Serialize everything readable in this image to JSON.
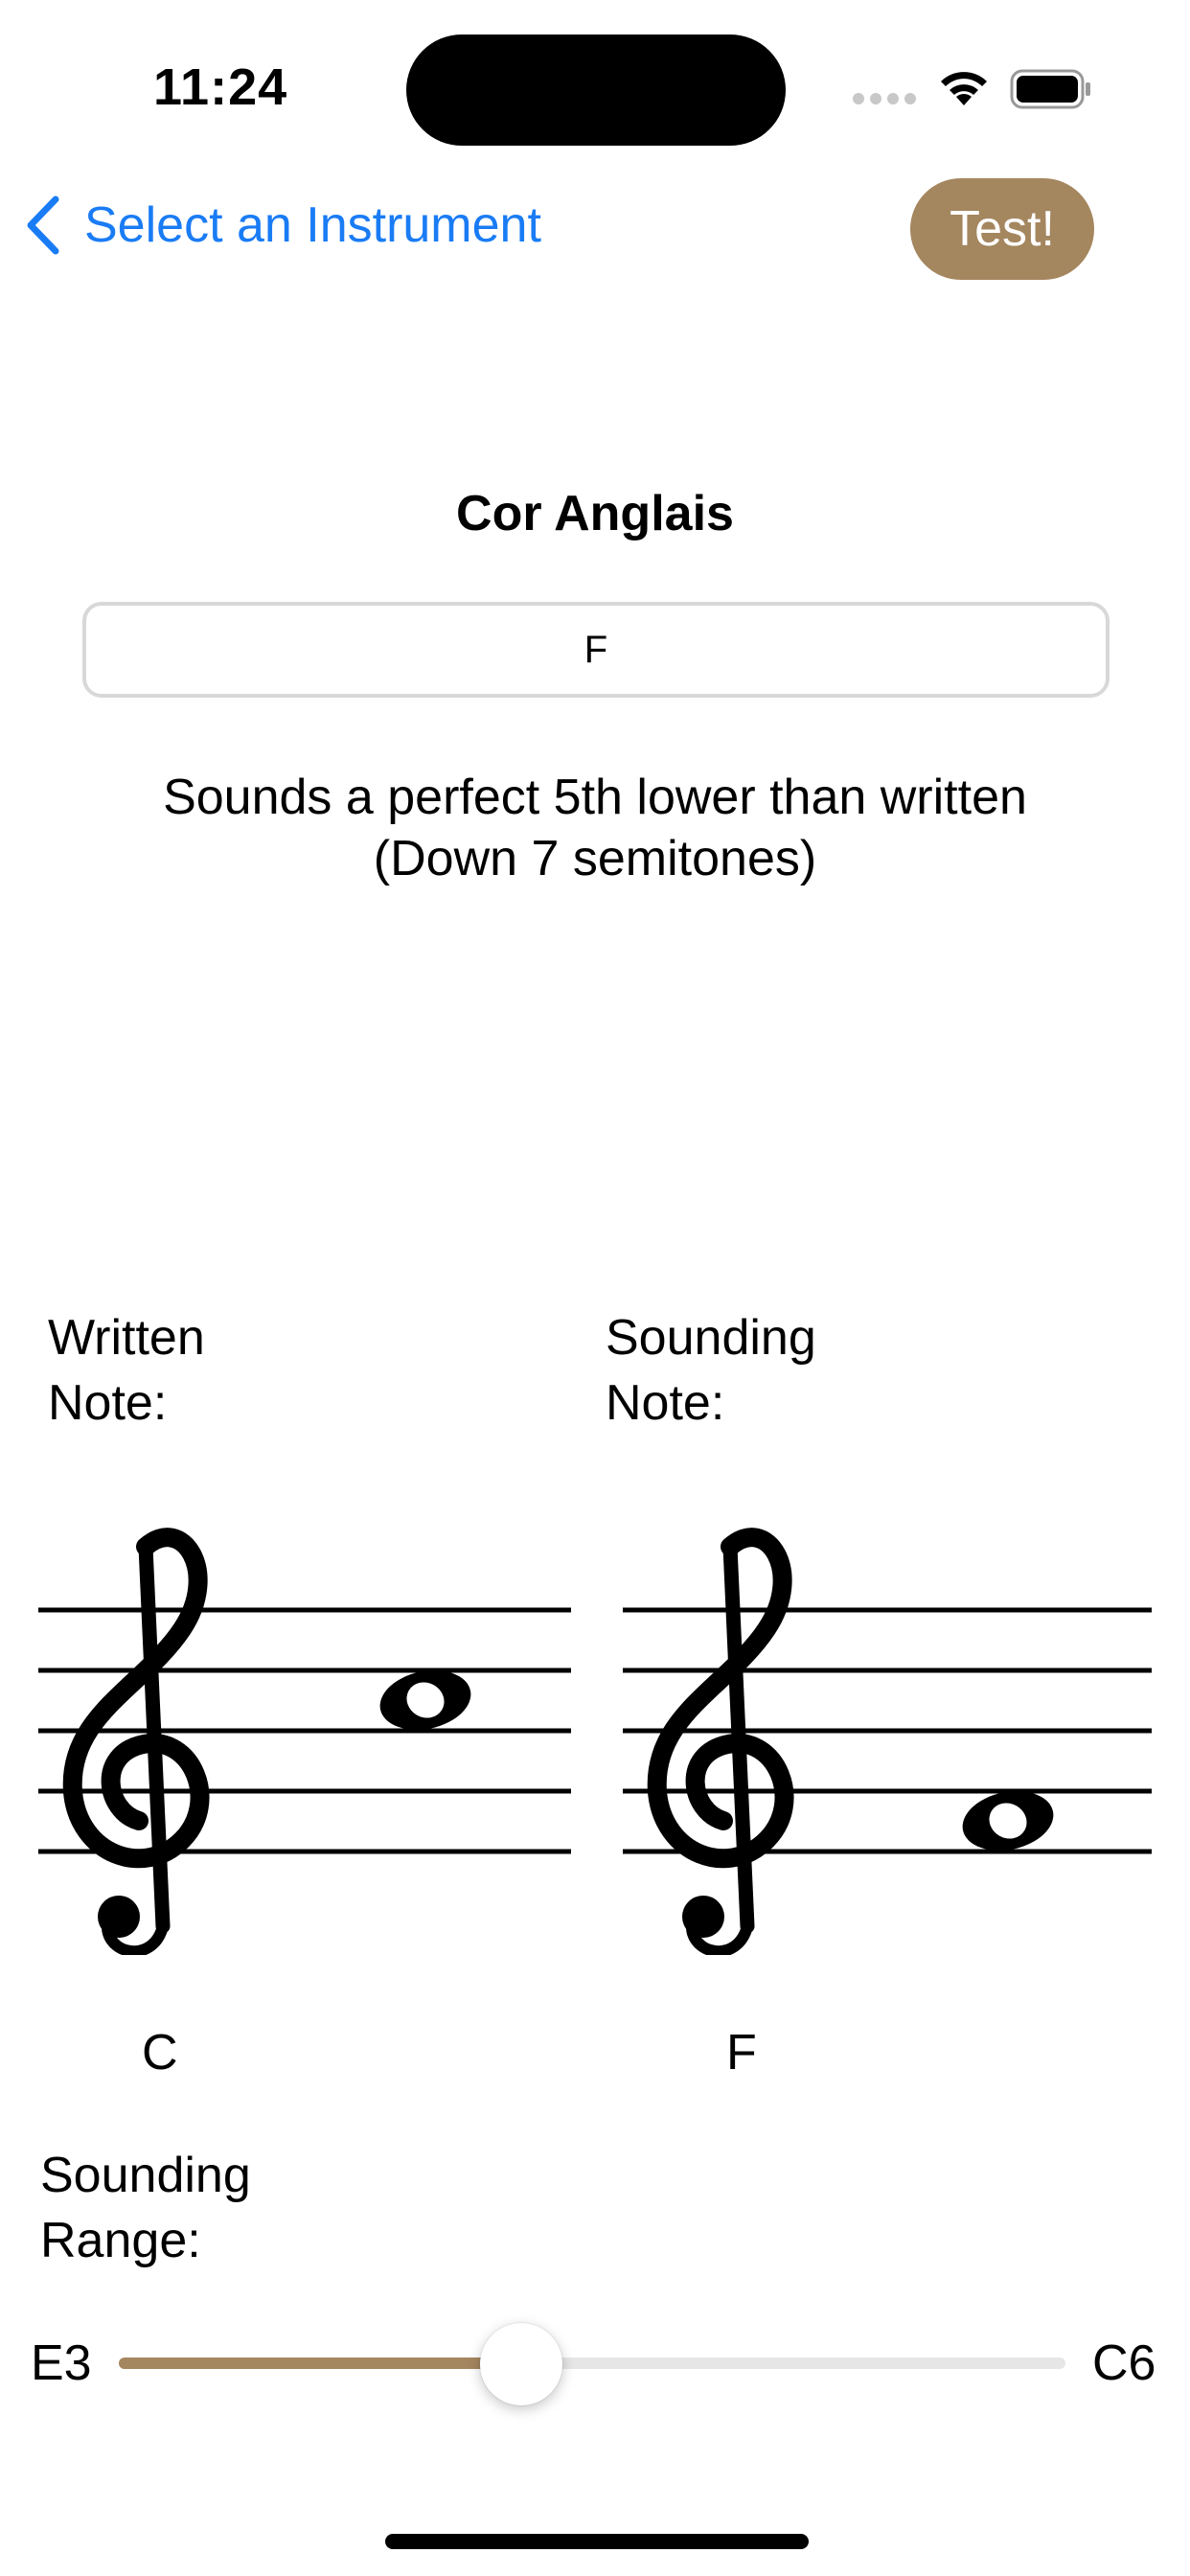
{
  "status_bar": {
    "time": "11:24"
  },
  "nav": {
    "back_label": "Select an Instrument",
    "test_label": "Test!"
  },
  "instrument": {
    "name": "Cor Anglais",
    "key": "F",
    "transposition_line1": "Sounds a perfect 5th lower than written",
    "transposition_line2": "(Down 7 semitones)"
  },
  "written": {
    "label_line1": "Written",
    "label_line2": "Note:",
    "note": "C"
  },
  "sounding": {
    "label_line1": "Sounding",
    "label_line2": "Note:",
    "note": "F"
  },
  "range": {
    "label_line1": "Sounding",
    "label_line2": "Range:",
    "min": "E3",
    "max": "C6",
    "position": 0.425
  },
  "colors": {
    "accent": "#a4865f",
    "link": "#1a7cf5",
    "track": "#e6e6e6"
  }
}
